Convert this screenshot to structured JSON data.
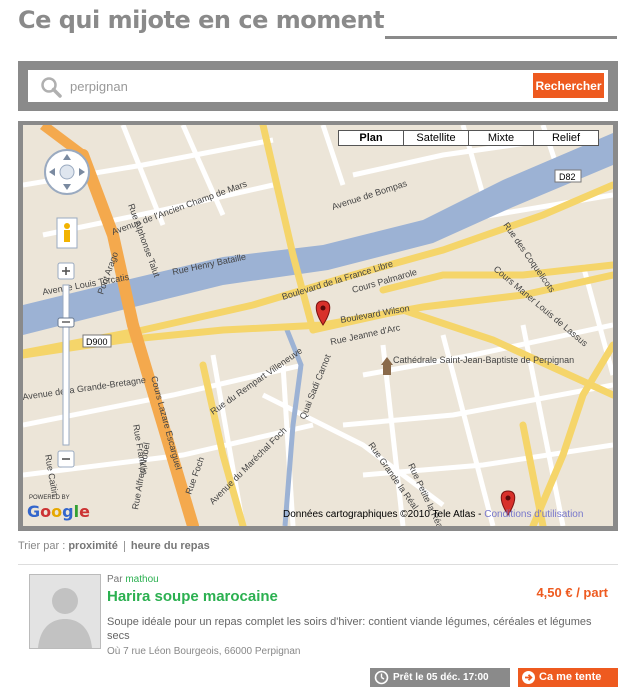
{
  "page": {
    "title": "Ce qui mijote en ce moment"
  },
  "search": {
    "value": "perpignan",
    "button_label": "Rechercher"
  },
  "map": {
    "types": [
      "Plan",
      "Satellite",
      "Mixte",
      "Relief"
    ],
    "active_type": "Plan",
    "credit": "Données cartographiques ©2010 Tele Atlas -",
    "terms_link": "Conditions d'utilisation",
    "powered_by": "POWERED BY",
    "logo_letters": [
      "G",
      "o",
      "o",
      "g",
      "l",
      "e"
    ],
    "colors": {
      "land": "#ece5d8",
      "river": "#9cb2d4",
      "road_major": "#f5d56a",
      "road_motorway": "#f4a94d",
      "road_minor": "#ffffff",
      "marker": "#d8312b"
    },
    "labels": {
      "boulevard_france_libre": "Boulevard de la France Libre",
      "boulevard_wilson": "Boulevard Wilson",
      "cours_palmarole": "Cours Palmarole",
      "avenue_bompas": "Avenue de Bompas",
      "avenue_louis_torcatis": "Avenue Louis Torcatis",
      "cours_lazare_escarguel": "Cours Lazare Escarguel",
      "pont_arago": "Pont Arago",
      "quai_sadi_carnot": "Quai Sadi Carnot",
      "rue_jeanne_arc": "Rue Jeanne d'Arc",
      "cathedrale": "Cathédrale Saint-Jean-Baptiste de Perpignan",
      "rue_du_rempart_villeneuve": "Rue du Rempart Villeneuve",
      "rue_grande_la_real": "Rue Grande la Réal",
      "rue_petite_la_real": "Rue Petite la Réal",
      "avenue_marechal_foch": "Avenue du Maréchal Foch",
      "d900": "D900",
      "d82": "D82",
      "rue_henry_bataille": "Rue Henry Bataille",
      "avenue_ancien_champ_de_mars": "Avenue de l'Ancien Champ de Mars",
      "rue_alphonse_talut": "Rue Alphonse Talut",
      "rue_des_coquelicots": "Rue des Coquelicots",
      "cours_maner_louis_de_lassus": "Cours Maner Louis de Lassus",
      "avenue_de_la_grande_bretagne": "Avenue de la Grande-Bretagne",
      "rue_franklin": "Rue Franklin",
      "rue_alfred_nobel": "Rue Alfred Nobel",
      "rue_caitin": "Rue Caitin",
      "rue_foch": "Rue Foch"
    }
  },
  "sort": {
    "label": "Trier par :",
    "options": [
      "proximité",
      "heure du repas"
    ]
  },
  "listing": {
    "author_prefix": "Par",
    "author": "mathou",
    "title": "Harira soupe marocaine",
    "price": "4,50 € / part",
    "description": "Soupe idéale pour un repas complet les soirs d'hiver: contient viande légumes, céréales et légumes secs",
    "address": "Où 7 rue Léon Bourgeois, 66000 Perpignan",
    "ready": "Prêt le 05 déc. 17:00",
    "cta_label": "Ca me tente"
  }
}
